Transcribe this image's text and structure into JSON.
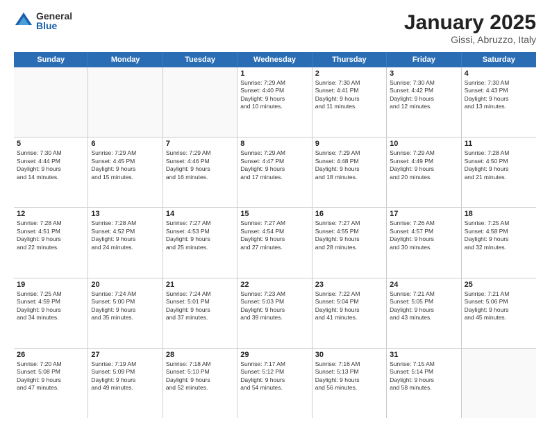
{
  "logo": {
    "general": "General",
    "blue": "Blue"
  },
  "title": "January 2025",
  "location": "Gissi, Abruzzo, Italy",
  "days": [
    "Sunday",
    "Monday",
    "Tuesday",
    "Wednesday",
    "Thursday",
    "Friday",
    "Saturday"
  ],
  "rows": [
    [
      {
        "day": "",
        "info": ""
      },
      {
        "day": "",
        "info": ""
      },
      {
        "day": "",
        "info": ""
      },
      {
        "day": "1",
        "info": "Sunrise: 7:29 AM\nSunset: 4:40 PM\nDaylight: 9 hours\nand 10 minutes."
      },
      {
        "day": "2",
        "info": "Sunrise: 7:30 AM\nSunset: 4:41 PM\nDaylight: 9 hours\nand 11 minutes."
      },
      {
        "day": "3",
        "info": "Sunrise: 7:30 AM\nSunset: 4:42 PM\nDaylight: 9 hours\nand 12 minutes."
      },
      {
        "day": "4",
        "info": "Sunrise: 7:30 AM\nSunset: 4:43 PM\nDaylight: 9 hours\nand 13 minutes."
      }
    ],
    [
      {
        "day": "5",
        "info": "Sunrise: 7:30 AM\nSunset: 4:44 PM\nDaylight: 9 hours\nand 14 minutes."
      },
      {
        "day": "6",
        "info": "Sunrise: 7:29 AM\nSunset: 4:45 PM\nDaylight: 9 hours\nand 15 minutes."
      },
      {
        "day": "7",
        "info": "Sunrise: 7:29 AM\nSunset: 4:46 PM\nDaylight: 9 hours\nand 16 minutes."
      },
      {
        "day": "8",
        "info": "Sunrise: 7:29 AM\nSunset: 4:47 PM\nDaylight: 9 hours\nand 17 minutes."
      },
      {
        "day": "9",
        "info": "Sunrise: 7:29 AM\nSunset: 4:48 PM\nDaylight: 9 hours\nand 18 minutes."
      },
      {
        "day": "10",
        "info": "Sunrise: 7:29 AM\nSunset: 4:49 PM\nDaylight: 9 hours\nand 20 minutes."
      },
      {
        "day": "11",
        "info": "Sunrise: 7:28 AM\nSunset: 4:50 PM\nDaylight: 9 hours\nand 21 minutes."
      }
    ],
    [
      {
        "day": "12",
        "info": "Sunrise: 7:28 AM\nSunset: 4:51 PM\nDaylight: 9 hours\nand 22 minutes."
      },
      {
        "day": "13",
        "info": "Sunrise: 7:28 AM\nSunset: 4:52 PM\nDaylight: 9 hours\nand 24 minutes."
      },
      {
        "day": "14",
        "info": "Sunrise: 7:27 AM\nSunset: 4:53 PM\nDaylight: 9 hours\nand 25 minutes."
      },
      {
        "day": "15",
        "info": "Sunrise: 7:27 AM\nSunset: 4:54 PM\nDaylight: 9 hours\nand 27 minutes."
      },
      {
        "day": "16",
        "info": "Sunrise: 7:27 AM\nSunset: 4:55 PM\nDaylight: 9 hours\nand 28 minutes."
      },
      {
        "day": "17",
        "info": "Sunrise: 7:26 AM\nSunset: 4:57 PM\nDaylight: 9 hours\nand 30 minutes."
      },
      {
        "day": "18",
        "info": "Sunrise: 7:25 AM\nSunset: 4:58 PM\nDaylight: 9 hours\nand 32 minutes."
      }
    ],
    [
      {
        "day": "19",
        "info": "Sunrise: 7:25 AM\nSunset: 4:59 PM\nDaylight: 9 hours\nand 34 minutes."
      },
      {
        "day": "20",
        "info": "Sunrise: 7:24 AM\nSunset: 5:00 PM\nDaylight: 9 hours\nand 35 minutes."
      },
      {
        "day": "21",
        "info": "Sunrise: 7:24 AM\nSunset: 5:01 PM\nDaylight: 9 hours\nand 37 minutes."
      },
      {
        "day": "22",
        "info": "Sunrise: 7:23 AM\nSunset: 5:03 PM\nDaylight: 9 hours\nand 39 minutes."
      },
      {
        "day": "23",
        "info": "Sunrise: 7:22 AM\nSunset: 5:04 PM\nDaylight: 9 hours\nand 41 minutes."
      },
      {
        "day": "24",
        "info": "Sunrise: 7:21 AM\nSunset: 5:05 PM\nDaylight: 9 hours\nand 43 minutes."
      },
      {
        "day": "25",
        "info": "Sunrise: 7:21 AM\nSunset: 5:06 PM\nDaylight: 9 hours\nand 45 minutes."
      }
    ],
    [
      {
        "day": "26",
        "info": "Sunrise: 7:20 AM\nSunset: 5:08 PM\nDaylight: 9 hours\nand 47 minutes."
      },
      {
        "day": "27",
        "info": "Sunrise: 7:19 AM\nSunset: 5:09 PM\nDaylight: 9 hours\nand 49 minutes."
      },
      {
        "day": "28",
        "info": "Sunrise: 7:18 AM\nSunset: 5:10 PM\nDaylight: 9 hours\nand 52 minutes."
      },
      {
        "day": "29",
        "info": "Sunrise: 7:17 AM\nSunset: 5:12 PM\nDaylight: 9 hours\nand 54 minutes."
      },
      {
        "day": "30",
        "info": "Sunrise: 7:16 AM\nSunset: 5:13 PM\nDaylight: 9 hours\nand 56 minutes."
      },
      {
        "day": "31",
        "info": "Sunrise: 7:15 AM\nSunset: 5:14 PM\nDaylight: 9 hours\nand 58 minutes."
      },
      {
        "day": "",
        "info": ""
      }
    ]
  ]
}
